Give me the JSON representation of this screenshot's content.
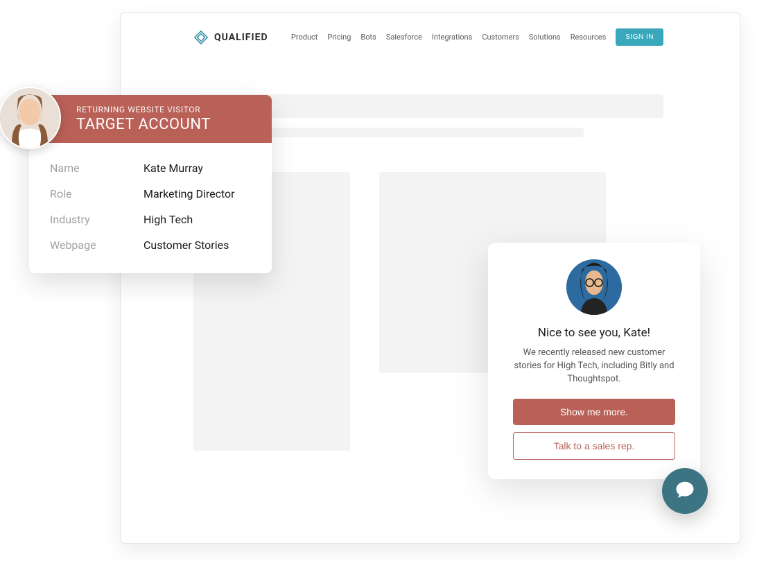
{
  "brand": {
    "name": "QUALIFIED"
  },
  "nav": {
    "items": [
      {
        "label": "Product"
      },
      {
        "label": "Pricing"
      },
      {
        "label": "Bots"
      },
      {
        "label": "Salesforce"
      },
      {
        "label": "Integrations"
      },
      {
        "label": "Customers"
      },
      {
        "label": "Solutions"
      },
      {
        "label": "Resources"
      }
    ],
    "signin": "SIGN IN"
  },
  "visitor": {
    "subtitle": "RETURNING WEBSITE VISITOR",
    "title": "TARGET ACCOUNT",
    "fields": [
      {
        "label": "Name",
        "value": "Kate Murray"
      },
      {
        "label": "Role",
        "value": "Marketing Director"
      },
      {
        "label": "Industry",
        "value": "High Tech"
      },
      {
        "label": "Webpage",
        "value": "Customer Stories"
      }
    ]
  },
  "chat": {
    "greeting": "Nice to see you, Kate!",
    "message": "We recently released new customer stories for High Tech, including Bitly and Thoughtspot.",
    "primary_cta": "Show me more.",
    "secondary_cta": "Talk to a sales rep."
  },
  "colors": {
    "accent_red": "#b96057",
    "accent_teal": "#3aa7bd",
    "launcher": "#3c7483"
  }
}
